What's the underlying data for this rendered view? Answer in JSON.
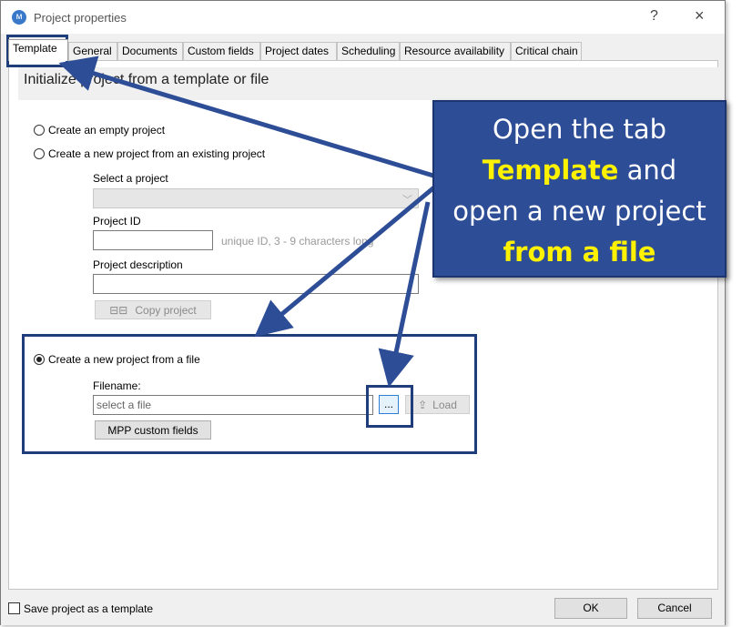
{
  "window": {
    "title": "Project properties",
    "help_label": "?",
    "close_label": "×"
  },
  "tabs": [
    {
      "label": "Template",
      "active": true
    },
    {
      "label": "General"
    },
    {
      "label": "Documents"
    },
    {
      "label": "Custom fields"
    },
    {
      "label": "Project dates"
    },
    {
      "label": "Scheduling"
    },
    {
      "label": "Resource availability"
    },
    {
      "label": "Critical chain"
    }
  ],
  "template": {
    "header": "Initialize project from a template or file",
    "option_empty": "Create an empty project",
    "option_existing": "Create a new project from an existing project",
    "select_project_label": "Select a project",
    "project_id_label": "Project ID",
    "project_id_value": "",
    "project_id_hint": "unique ID, 3 - 9 characters long",
    "project_description_label": "Project description",
    "project_description_value": "",
    "copy_project_label": "Copy project",
    "option_file": "Create a new project from a file",
    "selected_option": "file",
    "filename_label": "Filename:",
    "filename_placeholder": "select a file",
    "browse_label": "...",
    "load_label": "Load",
    "mpp_custom_fields_label": "MPP custom fields"
  },
  "footer": {
    "save_template_label": "Save project as a template",
    "save_template_checked": false,
    "ok_label": "OK",
    "cancel_label": "Cancel"
  },
  "callout": {
    "line1": "Open the tab",
    "line2_bold": "Template",
    "line2_rest": " and",
    "line3": "open a new project",
    "line4_bold": "from a file"
  },
  "colors": {
    "callout_bg": "#2d4d96",
    "callout_highlight": "#fff200",
    "annotation_box": "#1f3d7a",
    "dialog_bg": "#f0f0f0"
  }
}
